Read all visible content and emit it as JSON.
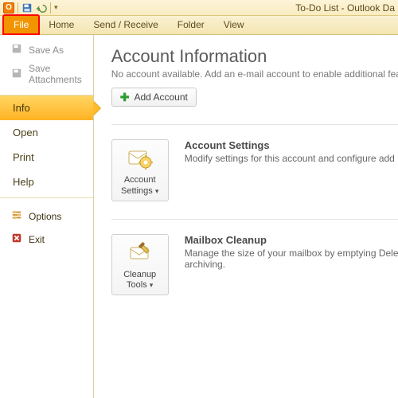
{
  "window_title": "To-Do List - Outlook Da",
  "tabs": {
    "file": "File",
    "home": "Home",
    "send_receive": "Send / Receive",
    "folder": "Folder",
    "view": "View"
  },
  "nav": {
    "save_as": "Save As",
    "save_attachments": "Save Attachments",
    "info": "Info",
    "open": "Open",
    "print": "Print",
    "help": "Help",
    "options": "Options",
    "exit": "Exit"
  },
  "content": {
    "heading": "Account Information",
    "no_account": "No account available. Add an e-mail account to enable additional featu",
    "add_account": "Add Account",
    "sections": {
      "account_settings": {
        "button_line1": "Account",
        "button_line2": "Settings",
        "title": "Account Settings",
        "desc": "Modify settings for this account and configure add"
      },
      "mailbox_cleanup": {
        "button_line1": "Cleanup",
        "button_line2": "Tools",
        "title": "Mailbox Cleanup",
        "desc1": "Manage the size of your mailbox by emptying Dele",
        "desc2": "archiving."
      }
    }
  }
}
